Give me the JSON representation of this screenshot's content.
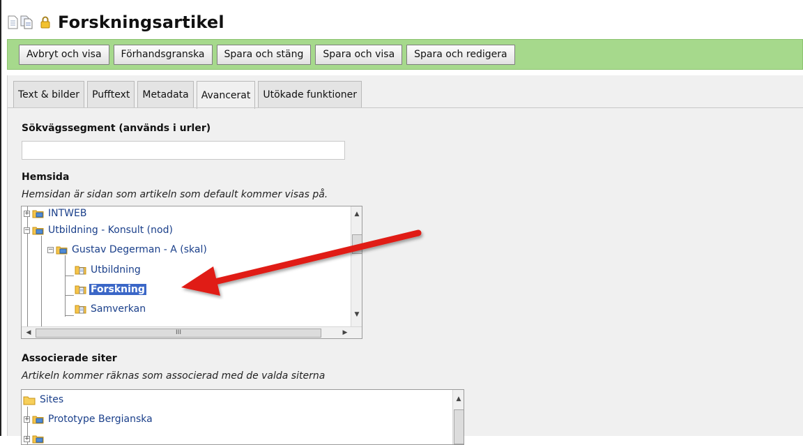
{
  "page": {
    "title": "Forskningsartikel"
  },
  "toolbar": {
    "buttons": [
      "Avbryt och visa",
      "Förhandsgranska",
      "Spara och stäng",
      "Spara och visa",
      "Spara och redigera"
    ]
  },
  "tabs": [
    "Text & bilder",
    "Pufftext",
    "Metadata",
    "Avancerat",
    "Utökade funktioner"
  ],
  "active_tab": "Avancerat",
  "form": {
    "path_segment": {
      "label": "Sökvägssegment (används i urler)",
      "value": ""
    },
    "homepage": {
      "label": "Hemsida",
      "help": "Hemsidan är sidan som artikeln som default kommer visas på.",
      "tree": [
        "INTWEB",
        "Utbildning - Konsult (nod)",
        "Gustav Degerman - A (skal)",
        "Utbildning",
        "Forskning",
        "Samverkan"
      ],
      "selected": "Forskning",
      "hscroll_grip": "III"
    },
    "associated_sites": {
      "label": "Associerade siter",
      "help": "Artikeln kommer räknas som associerad med de valda siterna",
      "tree": [
        "Sites",
        "Prototype Bergianska"
      ]
    }
  },
  "colors": {
    "toolbar_bg": "#a6d98c",
    "selection": "#3b67c7",
    "arrow": "#e01b12",
    "link": "#1a3f8a"
  }
}
